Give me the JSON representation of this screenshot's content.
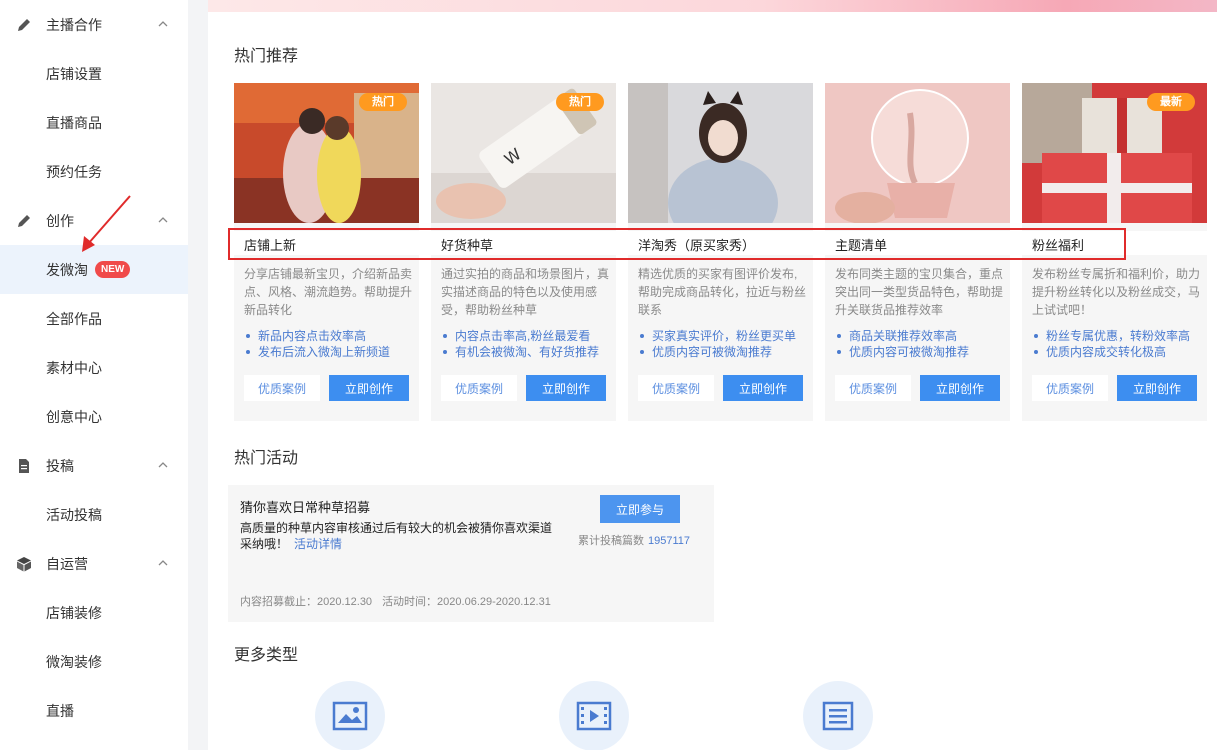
{
  "sidebar": {
    "groups": [
      {
        "label": "主播合作",
        "icon": "pencil-icon"
      },
      {
        "label": "创作",
        "icon": "pencil-icon"
      },
      {
        "label": "投稿",
        "icon": "document-icon"
      },
      {
        "label": "自运营",
        "icon": "box-icon"
      }
    ],
    "items": [
      {
        "label": "店铺设置"
      },
      {
        "label": "直播商品"
      },
      {
        "label": "预约任务"
      },
      {
        "label": "发微淘",
        "badge": "NEW"
      },
      {
        "label": "全部作品"
      },
      {
        "label": "素材中心"
      },
      {
        "label": "创意中心"
      },
      {
        "label": "活动投稿"
      },
      {
        "label": "店铺装修"
      },
      {
        "label": "微淘装修"
      },
      {
        "label": "直播"
      }
    ]
  },
  "main": {
    "hot_title": "热门推荐",
    "cards": [
      {
        "tag": "热门",
        "title": "店铺上新",
        "desc": "分享店铺最新宝贝，介绍新品卖点、风格、潮流趋势。帮助提升新品转化",
        "bullets": [
          "新品内容点击效率高",
          "发布后流入微淘上新频道"
        ],
        "case_label": "优质案例",
        "create_label": "立即创作"
      },
      {
        "tag": "热门",
        "title": "好货种草",
        "desc": "通过实拍的商品和场景图片，真实描述商品的特色以及使用感受，帮助粉丝种草",
        "bullets": [
          "内容点击率高,粉丝最爱看",
          "有机会被微淘、有好货推荐"
        ],
        "case_label": "优质案例",
        "create_label": "立即创作"
      },
      {
        "tag": "",
        "title": "洋淘秀（原买家秀）",
        "desc": "精选优质的买家有图评价发布,帮助完成商品转化，拉近与粉丝联系",
        "bullets": [
          "买家真实评价，粉丝更买单",
          "优质内容可被微淘推荐"
        ],
        "case_label": "优质案例",
        "create_label": "立即创作"
      },
      {
        "tag": "",
        "title": "主题清单",
        "desc": "发布同类主题的宝贝集合，重点突出同一类型货品特色，帮助提升关联货品推荐效率",
        "bullets": [
          "商品关联推荐效率高",
          "优质内容可被微淘推荐"
        ],
        "case_label": "优质案例",
        "create_label": "立即创作"
      },
      {
        "tag": "最新",
        "title": "粉丝福利",
        "desc": "发布粉丝专属折和福利价，助力提升粉丝转化以及粉丝成交，马上试试吧！",
        "bullets": [
          "粉丝专属优惠，转粉效率高",
          "优质内容成交转化极高"
        ],
        "case_label": "优质案例",
        "create_label": "立即创作"
      }
    ],
    "activity_title": "热门活动",
    "activity": {
      "title": "猜你喜欢日常种草招募",
      "desc": "高质量的种草内容审核通过后有较大的机会被猜你喜欢渠道采纳哦！",
      "link": "活动详情",
      "join_label": "立即参与",
      "count_label": "累计投稿篇数",
      "count_value": "1957117",
      "deadline": "内容招募截止：2020.12.30",
      "period": "活动时间：2020.06.29-2020.12.31"
    },
    "more_title": "更多类型",
    "more_types": [
      {
        "icon": "image-icon"
      },
      {
        "icon": "video-icon"
      },
      {
        "icon": "article-icon"
      }
    ]
  },
  "colors": {
    "accent": "#3d8ef0",
    "link": "#4a7bd0",
    "badge": "#f04a4a",
    "tag": "#ff9a1f",
    "highlight": "#e02b2b",
    "active_bg": "#ecf3fc"
  }
}
